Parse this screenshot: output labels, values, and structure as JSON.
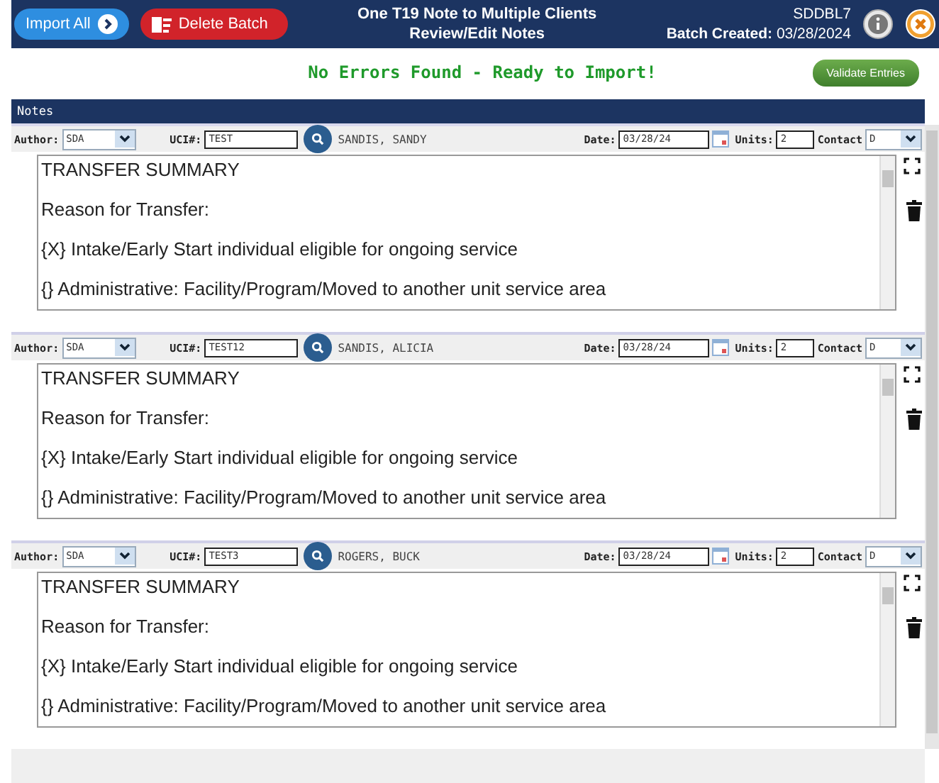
{
  "header": {
    "import_button": "Import All",
    "delete_button": "Delete Batch",
    "title_lines": [
      "One T19 Note to Multiple Clients",
      "Review/Edit Notes"
    ],
    "batch_id": "SDDBL7",
    "batch_created_label": "Batch Created:",
    "batch_created_date": "03/28/2024"
  },
  "status_message": "No Errors Found - Ready to Import!",
  "validate_button": "Validate Entries",
  "section_title": "Notes",
  "notes": [
    {
      "author_label": "Author:",
      "author": "SDA",
      "uci_label": "UCI#:",
      "uci": "TEST",
      "client_name": "SANDIS, SANDY",
      "date_label": "Date:",
      "date": "03/28/24",
      "units_label": "Units:",
      "units": "2",
      "contact_label": "Contact",
      "contact": "D",
      "lines": [
        "TRANSFER SUMMARY",
        "Reason for Transfer:",
        "{X} Intake/Early Start individual eligible for ongoing service",
        "{} Administrative: Facility/Program/Moved to another unit service area"
      ]
    },
    {
      "author_label": "Author:",
      "author": "SDA",
      "uci_label": "UCI#:",
      "uci": "TEST12",
      "client_name": "SANDIS, ALICIA",
      "date_label": "Date:",
      "date": "03/28/24",
      "units_label": "Units:",
      "units": "2",
      "contact_label": "Contact",
      "contact": "D",
      "lines": [
        "TRANSFER SUMMARY",
        "Reason for Transfer:",
        "{X} Intake/Early Start individual eligible for ongoing service",
        "{} Administrative: Facility/Program/Moved to another unit service area"
      ]
    },
    {
      "author_label": "Author:",
      "author": "SDA",
      "uci_label": "UCI#:",
      "uci": "TEST3",
      "client_name": "ROGERS, BUCK",
      "date_label": "Date:",
      "date": "03/28/24",
      "units_label": "Units:",
      "units": "2",
      "contact_label": "Contact",
      "contact": "D",
      "lines": [
        "TRANSFER SUMMARY",
        "Reason for Transfer:",
        "{X} Intake/Early Start individual eligible for ongoing service",
        "{} Administrative: Facility/Program/Moved to another unit service area"
      ]
    }
  ]
}
